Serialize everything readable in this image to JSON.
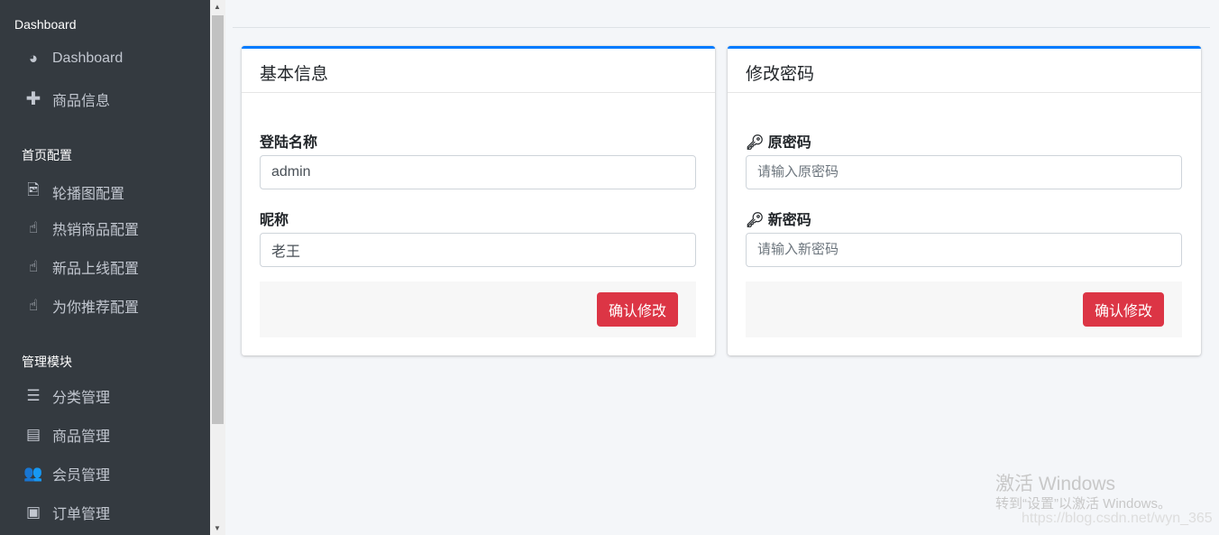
{
  "sidebar": {
    "sections": [
      "Dashboard",
      "首页配置",
      "管理模块"
    ],
    "items": [
      {
        "label": "Dashboard",
        "icon": "tachometer-icon"
      },
      {
        "label": "商品信息",
        "icon": "plus-icon"
      },
      {
        "label": "轮播图配置",
        "icon": "image-file-icon"
      },
      {
        "label": "热销商品配置",
        "icon": "hand-pointer-icon"
      },
      {
        "label": "新品上线配置",
        "icon": "hand-pointer-icon"
      },
      {
        "label": "为你推荐配置",
        "icon": "hand-pointer-icon"
      },
      {
        "label": "分类管理",
        "icon": "list-icon"
      },
      {
        "label": "商品管理",
        "icon": "archive-icon"
      },
      {
        "label": "会员管理",
        "icon": "users-icon"
      },
      {
        "label": "订单管理",
        "icon": "money-bill-icon"
      }
    ]
  },
  "basic": {
    "title": "基本信息",
    "login_label": "登陆名称",
    "login_value": "admin",
    "nick_label": "昵称",
    "nick_value": "老王",
    "submit": "确认修改"
  },
  "password": {
    "title": "修改密码",
    "old_label": "原密码",
    "old_placeholder": "请输入原密码",
    "new_label": "新密码",
    "new_placeholder": "请输入新密码",
    "submit": "确认修改"
  },
  "watermark": {
    "line1": "激活 Windows",
    "line2": "转到“设置”以激活 Windows。",
    "url": "https://blog.csdn.net/wyn_365"
  },
  "colors": {
    "primary": "#007bff",
    "danger": "#dc3545",
    "sidebar": "#343a40"
  }
}
